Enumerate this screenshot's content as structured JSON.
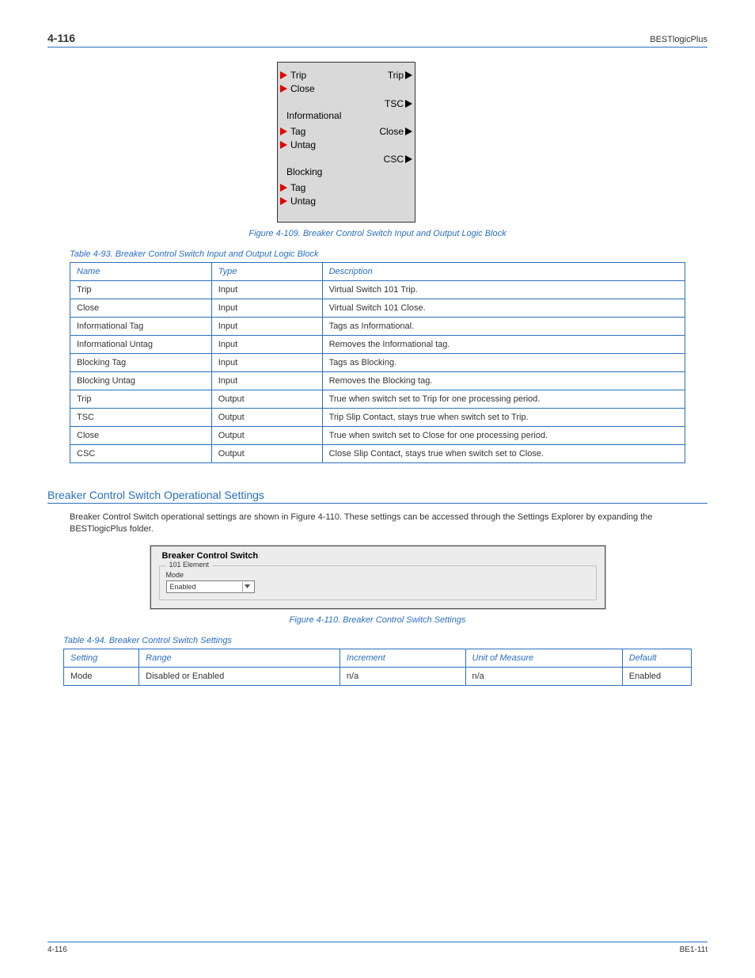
{
  "header": {
    "chapter": "4-116",
    "title": "BESTlogicPlus"
  },
  "diagram": {
    "left": [
      "Trip",
      "Close",
      "Tag",
      "Untag",
      "Tag",
      "Untag"
    ],
    "sections": [
      "Informational",
      "Blocking"
    ],
    "right": [
      "Trip",
      "TSC",
      "Close",
      "CSC"
    ]
  },
  "captions": {
    "fig109": "Figure 4-109. Breaker Control Switch Input and Output Logic Block",
    "tbl93": "Table 4-93. Breaker Control Switch Input and Output Logic Block",
    "fig110": "Figure 4-110. Breaker Control Switch Settings",
    "tbl94": "Table 4-94. Breaker Control Switch Settings"
  },
  "table1": {
    "headers": [
      "Name",
      "Type",
      "Description"
    ],
    "rows": [
      [
        "Trip",
        "Input",
        "Virtual Switch 101 Trip."
      ],
      [
        "Close",
        "Input",
        "Virtual Switch 101 Close."
      ],
      [
        "Informational Tag",
        "Input",
        "Tags as Informational."
      ],
      [
        "Informational Untag",
        "Input",
        "Removes the Informational tag."
      ],
      [
        "Blocking Tag",
        "Input",
        "Tags as Blocking."
      ],
      [
        "Blocking Untag",
        "Input",
        "Removes the Blocking tag."
      ],
      [
        "Trip",
        "Output",
        "True when switch set to Trip for one processing period."
      ],
      [
        "TSC",
        "Output",
        "Trip Slip Contact, stays true when switch set to Trip."
      ],
      [
        "Close",
        "Output",
        "True when switch set to Close for one processing period."
      ],
      [
        "CSC",
        "Output",
        "Close Slip Contact, stays true when switch set to Close."
      ]
    ]
  },
  "section": {
    "heading": "Breaker Control Switch Operational Settings",
    "para": "Breaker Control Switch operational settings are shown in Figure 4-110. These settings can be accessed through the Settings Explorer by expanding the BESTlogicPlus folder."
  },
  "shot": {
    "title": "Breaker Control Switch",
    "legend": "101 Element",
    "modeLabel": "Mode",
    "modeValue": "Enabled"
  },
  "table2": {
    "headers": [
      "Setting",
      "Range",
      "Increment",
      "Unit of Measure",
      "Default"
    ],
    "rows": [
      [
        "Mode",
        "Disabled or Enabled",
        "n/a",
        "n/a",
        "Enabled"
      ]
    ]
  },
  "footer": {
    "left": "4-116",
    "right": "BE1-11t"
  }
}
